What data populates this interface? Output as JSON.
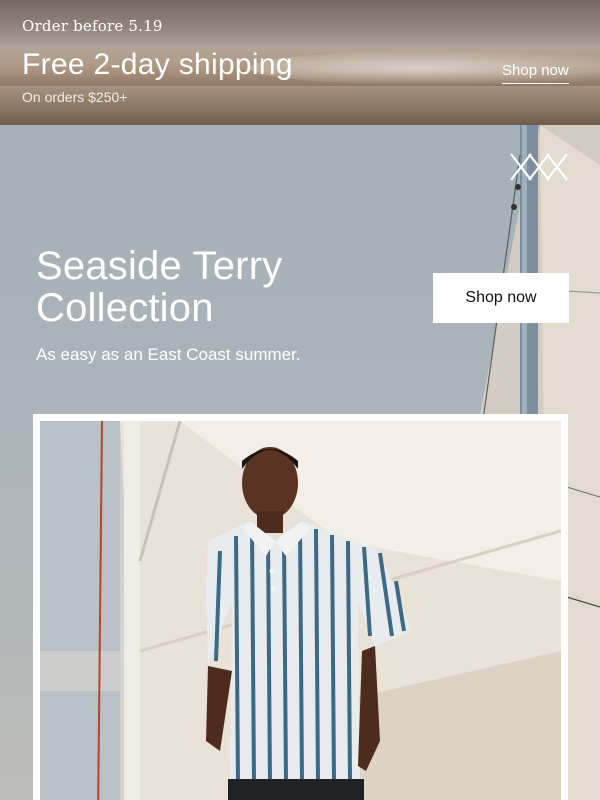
{
  "shipping_banner": {
    "eyebrow": "Order before 5.19",
    "title": "Free 2-day shipping",
    "subtitle": "On orders $250+",
    "link_label": "Shop now"
  },
  "hero": {
    "title_line1": "Seaside Terry",
    "title_line2": "Collection",
    "subtitle": "As easy as an East Coast summer.",
    "button_label": "Shop now",
    "logo_icon": "triple-x-brand-logo"
  },
  "product_photo": {
    "description_icon": "model-in-striped-polo-photo"
  },
  "colors": {
    "text_light": "#ffffff",
    "button_bg": "#ffffff",
    "button_text": "#111111",
    "sky": "#a6b0b7",
    "sand": "#b49e8a"
  }
}
